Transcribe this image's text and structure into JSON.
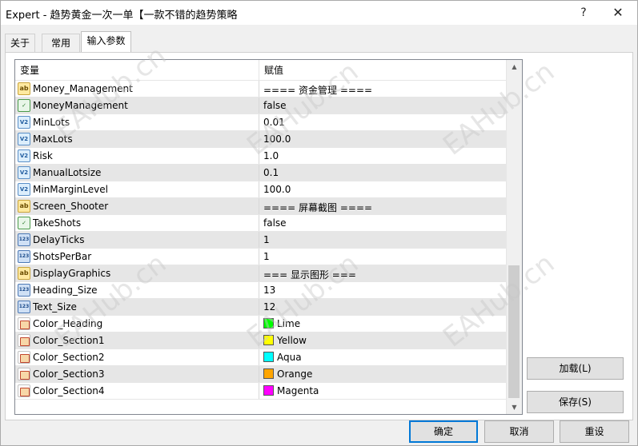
{
  "window": {
    "title": "Expert - 趋势黄金一次一单【一款不错的趋势策略",
    "help_glyph": "?",
    "close_glyph": "✕"
  },
  "tabs": [
    {
      "label": "关于",
      "active": false
    },
    {
      "label": "常用",
      "active": false
    },
    {
      "label": "输入参数",
      "active": true
    }
  ],
  "grid": {
    "header_variable": "变量",
    "header_value": "赋值",
    "rows": [
      {
        "icon": "string-icon",
        "name": "Money_Management",
        "value": "==== 资金管理 ===="
      },
      {
        "icon": "bool-icon",
        "name": "MoneyManagement",
        "value": "false"
      },
      {
        "icon": "double-icon",
        "name": "MinLots",
        "value": "0.01"
      },
      {
        "icon": "double-icon",
        "name": "MaxLots",
        "value": "100.0"
      },
      {
        "icon": "double-icon",
        "name": "Risk",
        "value": "1.0"
      },
      {
        "icon": "double-icon",
        "name": "ManualLotsize",
        "value": "0.1"
      },
      {
        "icon": "double-icon",
        "name": "MinMarginLevel",
        "value": "100.0"
      },
      {
        "icon": "string-icon",
        "name": "Screen_Shooter",
        "value": "==== 屏幕截图 ===="
      },
      {
        "icon": "bool-icon",
        "name": "TakeShots",
        "value": "false"
      },
      {
        "icon": "int-icon",
        "name": "DelayTicks",
        "value": "1"
      },
      {
        "icon": "int-icon",
        "name": "ShotsPerBar",
        "value": "1"
      },
      {
        "icon": "string-icon",
        "name": "DisplayGraphics",
        "value": "=== 显示图形 ==="
      },
      {
        "icon": "int-icon",
        "name": "Heading_Size",
        "value": "13"
      },
      {
        "icon": "int-icon",
        "name": "Text_Size",
        "value": "12"
      },
      {
        "icon": "color-icon",
        "name": "Color_Heading",
        "value": "Lime",
        "color": "#00ff00"
      },
      {
        "icon": "color-icon",
        "name": "Color_Section1",
        "value": "Yellow",
        "color": "#ffff00"
      },
      {
        "icon": "color-icon",
        "name": "Color_Section2",
        "value": "Aqua",
        "color": "#00ffff"
      },
      {
        "icon": "color-icon",
        "name": "Color_Section3",
        "value": "Orange",
        "color": "#ffa500"
      },
      {
        "icon": "color-icon",
        "name": "Color_Section4",
        "value": "Magenta",
        "color": "#ff00ff"
      }
    ],
    "scroll_fraction": 1.0
  },
  "icon_text": {
    "string-icon": "ab",
    "bool-icon": "✓",
    "double-icon": "V2",
    "int-icon": "123",
    "color-icon": ""
  },
  "side_buttons": {
    "load": "加载(L)",
    "save": "保存(S)"
  },
  "bottom_buttons": {
    "ok": "确定",
    "cancel": "取消",
    "reset": "重设"
  },
  "watermark": "EAHub.cn"
}
